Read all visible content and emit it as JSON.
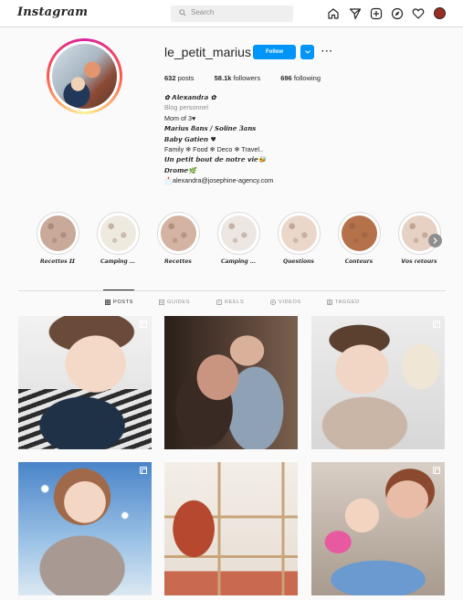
{
  "nav": {
    "logo": "Instagram",
    "search_placeholder": "Search"
  },
  "profile": {
    "username": "le_petit_marius",
    "follow_label": "Follow",
    "more_label": "···",
    "posts_count": "632",
    "posts_label": "posts",
    "followers_count": "58.1k",
    "followers_label": "followers",
    "following_count": "696",
    "following_label": "following",
    "bio": {
      "name": "✿ 𝘼𝙡𝙚𝙭𝙖𝙣𝙙𝙧𝙖 ✿",
      "category": "Blog personnel",
      "line1": "Mom of 3♥",
      "line2": "𝙈𝙖𝙧𝙞𝙪𝙨 8ans / 𝙎𝙤𝙡𝙞𝙣𝙚 3ans",
      "line3": "𝘽𝙖𝙗𝙮 𝙂𝙖𝙩𝙞𝙚𝙣 ♥",
      "line4": "Family ❄ Food ❄ Deco ❄ Travel..",
      "line5": "𝙐𝙣 𝙥𝙚𝙩𝙞𝙩 𝙗𝙤𝙪𝙩 𝙙𝙚 𝙣𝙤𝙩𝙧𝙚 𝙫𝙞𝙚🐝",
      "line6": "𝘿𝙧𝙤𝙢𝙚🌿",
      "email": "📩alexandra@josephine-agency.com"
    }
  },
  "highlights": [
    {
      "label": "𝙍𝙚𝙘𝙚𝙩𝙩𝙚𝙨 𝙄𝙄",
      "color": "#c9a99a"
    },
    {
      "label": "𝘾𝙖𝙢𝙥𝙞𝙣𝙜 ...",
      "color": "#efeae0"
    },
    {
      "label": "𝙍𝙚𝙘𝙚𝙩𝙩𝙚𝙨",
      "color": "#d4b3a3"
    },
    {
      "label": "𝘾𝙖𝙢𝙥𝙞𝙣𝙜 ...",
      "color": "#ece7e3"
    },
    {
      "label": "𝙌𝙪𝙚𝙨𝙩𝙞𝙤𝙣𝙨",
      "color": "#ead7ca"
    },
    {
      "label": "𝘾𝙤𝙣𝙩𝙚𝙪𝙧𝙨",
      "color": "#b5714a"
    },
    {
      "label": "𝙑𝙤𝙨 𝙧𝙚𝙩𝙤𝙪𝙧𝙨",
      "color": "#e6d1c3"
    }
  ],
  "tabs": [
    {
      "label": "POSTS",
      "icon": "grid-icon"
    },
    {
      "label": "GUIDES",
      "icon": "guide-icon"
    },
    {
      "label": "REELS",
      "icon": "reels-icon"
    },
    {
      "label": "VIDEOS",
      "icon": "play-icon"
    },
    {
      "label": "TAGGED",
      "icon": "tag-icon"
    }
  ],
  "posts": [
    {
      "desc": "baby-portrait",
      "multi": true
    },
    {
      "desc": "couple-hug",
      "multi": false
    },
    {
      "desc": "baby-eating",
      "multi": true
    },
    {
      "desc": "girl-snow",
      "multi": true
    },
    {
      "desc": "kids-room",
      "multi": false
    },
    {
      "desc": "mom-daughter-play",
      "multi": true
    }
  ]
}
